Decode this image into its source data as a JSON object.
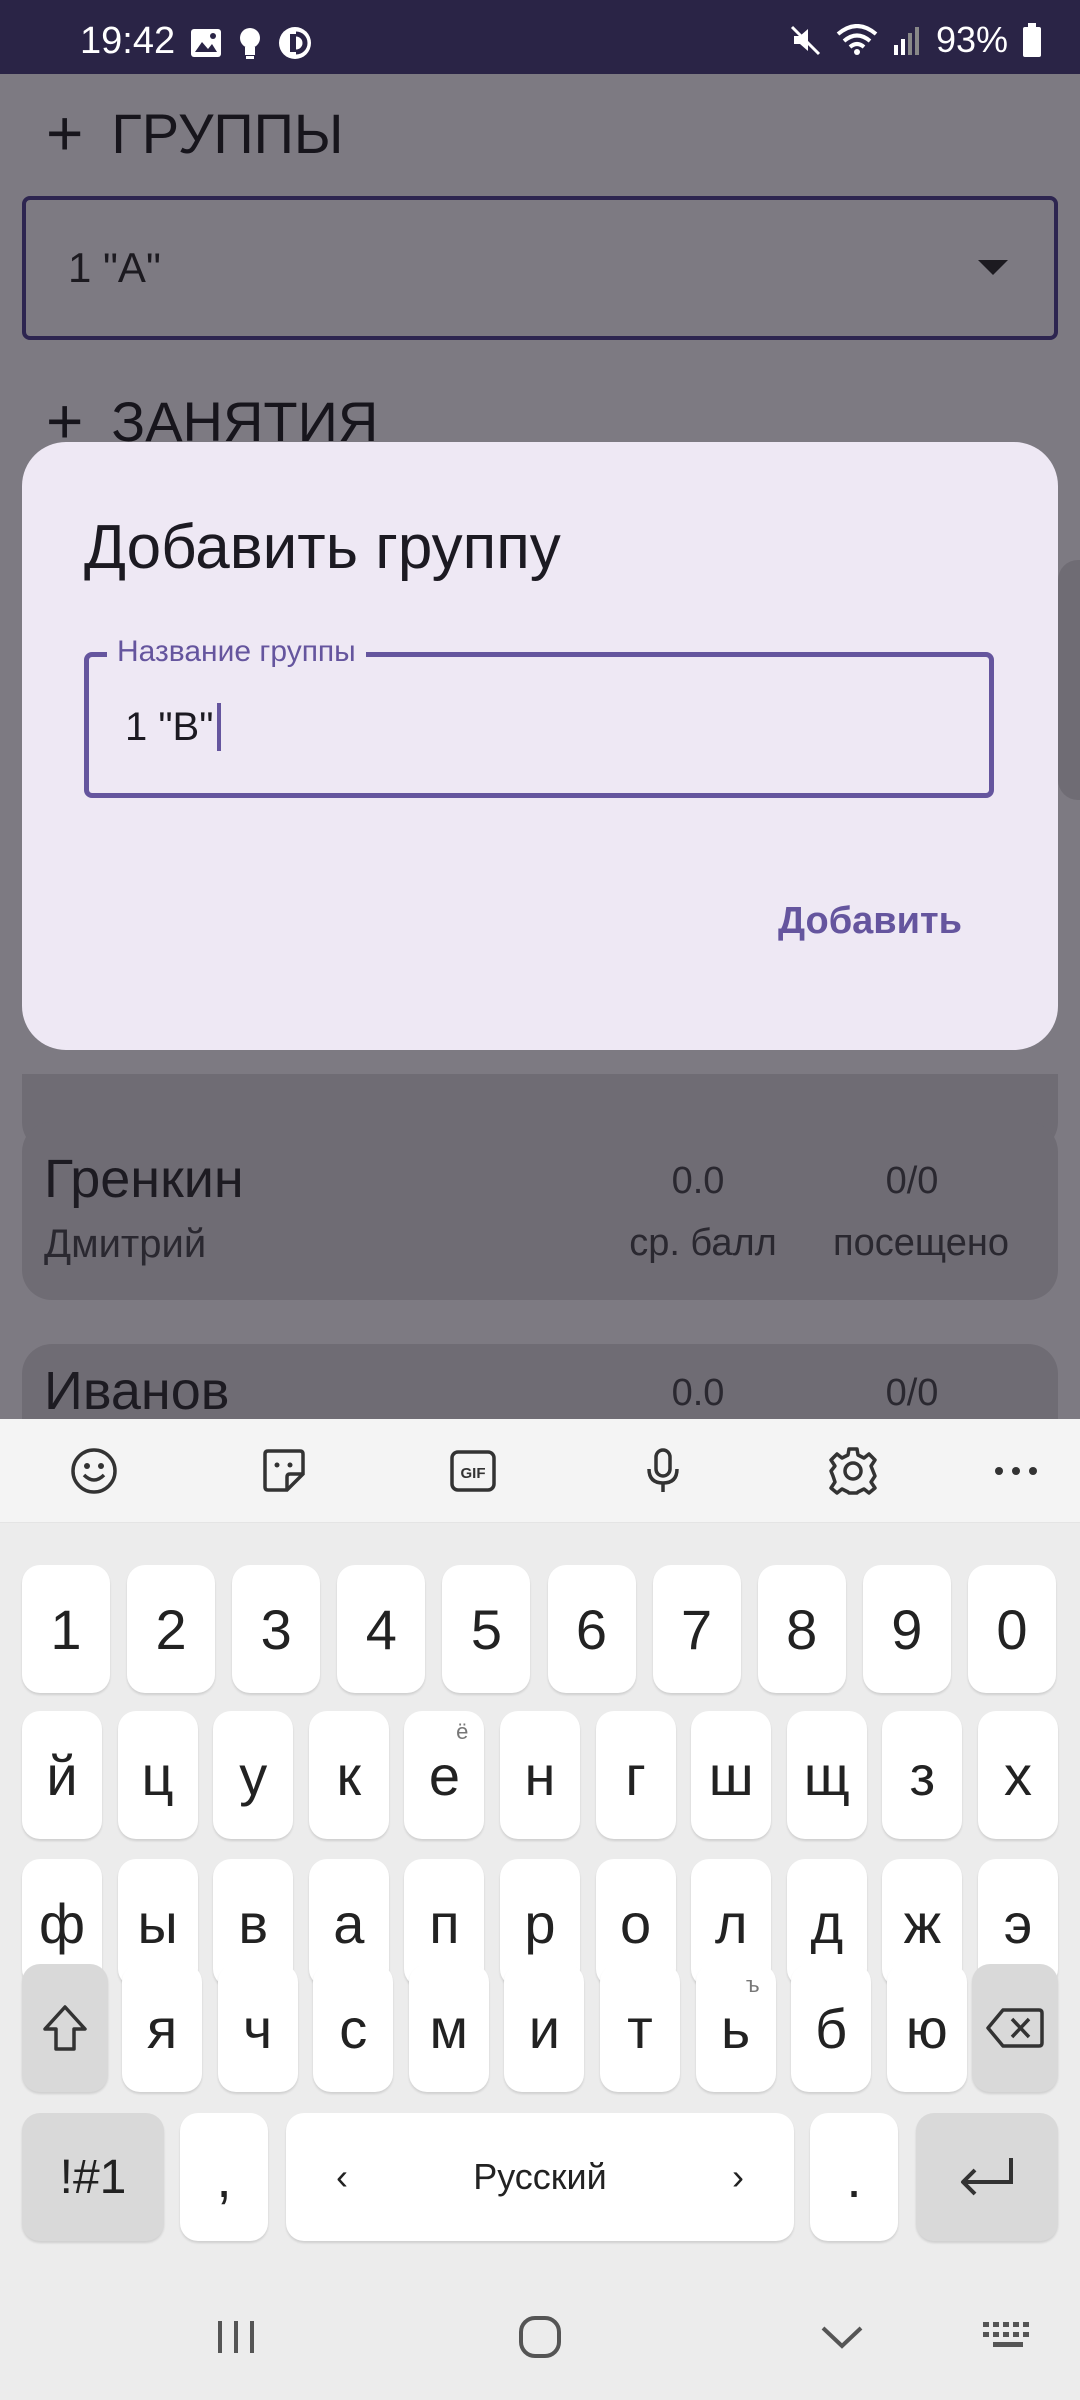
{
  "status_bar": {
    "time": "19:42",
    "battery": "93%"
  },
  "background": {
    "groups_header": "ГРУППЫ",
    "selected_group": "1 \"А\"",
    "lessons_header": "ЗАНЯТИЯ",
    "students": [
      {
        "last_name": "Гренкин",
        "first_name": "Дмитрий",
        "avg": "0.0",
        "avg_label": "ср. балл",
        "attended": "0/0",
        "attended_label": "посещено"
      },
      {
        "last_name": "Иванов",
        "avg": "0.0",
        "attended": "0/0"
      }
    ]
  },
  "dialog": {
    "title": "Добавить группу",
    "field_label": "Название группы",
    "field_value": "1 \"В\"",
    "action": "Добавить"
  },
  "keyboard": {
    "toolbar_icons": [
      "emoji-icon",
      "sticker-icon",
      "gif-icon",
      "microphone-icon",
      "settings-icon",
      "more-icon"
    ],
    "gif_label": "GIF",
    "row_numbers": [
      "1",
      "2",
      "3",
      "4",
      "5",
      "6",
      "7",
      "8",
      "9",
      "0"
    ],
    "row1": [
      "й",
      "ц",
      "у",
      "к",
      "е",
      "н",
      "г",
      "ш",
      "щ",
      "з",
      "х"
    ],
    "row1_hint_e": "ё",
    "row2": [
      "ф",
      "ы",
      "в",
      "а",
      "п",
      "р",
      "о",
      "л",
      "д",
      "ж",
      "э"
    ],
    "row3": [
      "я",
      "ч",
      "с",
      "м",
      "и",
      "т",
      "ь",
      "б",
      "ю"
    ],
    "row3_hint_soft": "ъ",
    "symbols_label": "!#1",
    "comma": ",",
    "period": ".",
    "language": "Русский",
    "lang_left": "‹",
    "lang_right": "›"
  },
  "colors": {
    "accent": "#65559e",
    "dialog_bg": "#eee8f4",
    "status_bar": "#2a2446"
  }
}
